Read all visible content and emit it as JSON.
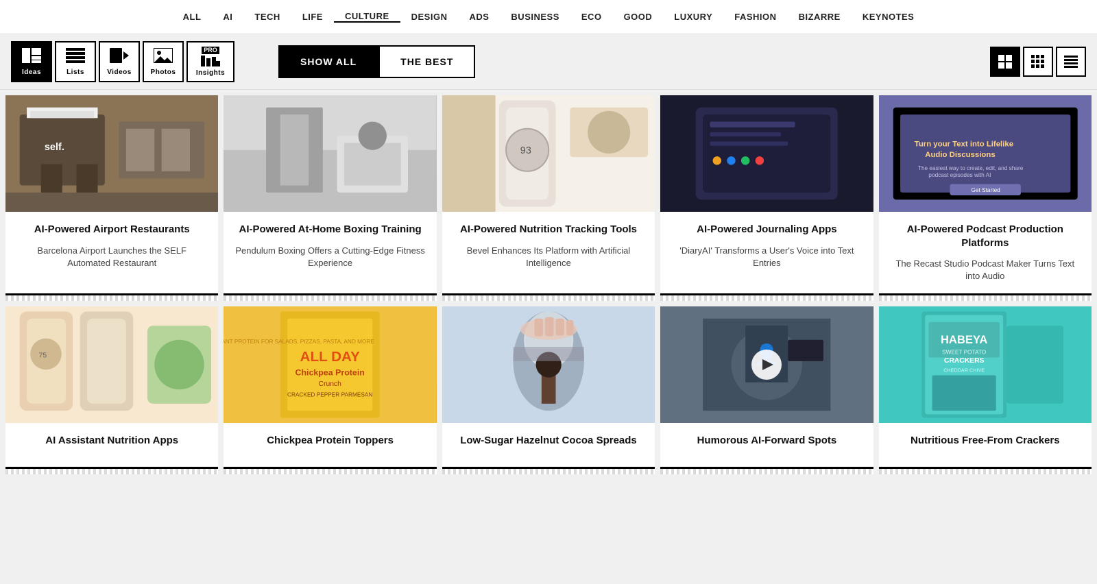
{
  "nav": {
    "items": [
      {
        "label": "ALL",
        "active": false
      },
      {
        "label": "AI",
        "active": false
      },
      {
        "label": "TECH",
        "active": false
      },
      {
        "label": "LIFE",
        "active": false
      },
      {
        "label": "CULTURE",
        "active": true
      },
      {
        "label": "DESIGN",
        "active": false
      },
      {
        "label": "ADS",
        "active": false
      },
      {
        "label": "BUSINESS",
        "active": false
      },
      {
        "label": "ECO",
        "active": false
      },
      {
        "label": "GOOD",
        "active": false
      },
      {
        "label": "LUXURY",
        "active": false
      },
      {
        "label": "FASHION",
        "active": false
      },
      {
        "label": "BIZARRE",
        "active": false
      },
      {
        "label": "KEYNOTES",
        "active": false
      }
    ]
  },
  "toolbar": {
    "views": [
      {
        "label": "Ideas",
        "icon": "📰",
        "active": true,
        "pro": false
      },
      {
        "label": "Lists",
        "icon": "≡",
        "active": false,
        "pro": false
      },
      {
        "label": "Videos",
        "icon": "🎬",
        "active": false,
        "pro": false
      },
      {
        "label": "Photos",
        "icon": "🖼",
        "active": false,
        "pro": false
      },
      {
        "label": "Insights",
        "pro": true
      }
    ],
    "filters": [
      {
        "label": "SHOW ALL",
        "active": true
      },
      {
        "label": "THE BEST",
        "active": false
      }
    ],
    "layouts": [
      {
        "icon": "▦",
        "active": true
      },
      {
        "icon": "⊞",
        "active": false
      },
      {
        "icon": "▤",
        "active": false
      }
    ]
  },
  "cards": {
    "row1": [
      {
        "title": "AI-Powered Airport Restaurants",
        "subtitle": "Barcelona Airport Launches the SELF Automated Restaurant",
        "img_class": "img-airport"
      },
      {
        "title": "AI-Powered At-Home Boxing Training",
        "subtitle": "Pendulum Boxing Offers a Cutting-Edge Fitness Experience",
        "img_class": "img-boxing"
      },
      {
        "title": "AI-Powered Nutrition Tracking Tools",
        "subtitle": "Bevel Enhances Its Platform with Artificial Intelligence",
        "img_class": "img-nutrition"
      },
      {
        "title": "AI-Powered Journaling Apps",
        "subtitle": "'DiaryAI' Transforms a User's Voice into Text Entries",
        "img_class": "img-journal"
      },
      {
        "title": "AI-Powered Podcast Production Platforms",
        "subtitle": "The Recast Studio Podcast Maker Turns Text into Audio",
        "img_class": "img-podcast"
      }
    ],
    "row2": [
      {
        "title": "AI Assistant Nutrition Apps",
        "subtitle": "",
        "img_class": "img-ai-nutrition",
        "has_video": false
      },
      {
        "title": "Chickpea Protein Toppers",
        "subtitle": "",
        "img_class": "img-chickpea",
        "has_video": false
      },
      {
        "title": "Low-Sugar Hazelnut Cocoa Spreads",
        "subtitle": "",
        "img_class": "img-hazelnut",
        "has_video": false
      },
      {
        "title": "Humorous AI-Forward Spots",
        "subtitle": "",
        "img_class": "img-humorous",
        "has_video": true
      },
      {
        "title": "Nutritious Free-From Crackers",
        "subtitle": "",
        "img_class": "img-crackers",
        "has_video": false
      }
    ]
  }
}
